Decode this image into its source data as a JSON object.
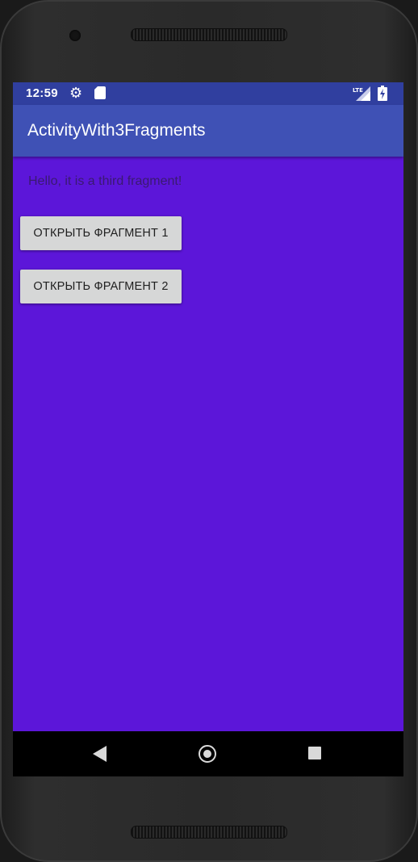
{
  "status_bar": {
    "time": "12:59",
    "icons": [
      "gear-icon",
      "sd-card-icon",
      "lte-signal-icon",
      "battery-icon"
    ],
    "network_label": "LTE"
  },
  "app_bar": {
    "title": "ActivityWith3Fragments"
  },
  "content": {
    "message": "Hello, it is a third fragment!",
    "buttons": [
      {
        "label": "ОТКРЫТЬ ФРАГМЕНТ 1"
      },
      {
        "label": "ОТКРЫТЬ ФРАГМЕНТ 2"
      }
    ]
  },
  "nav_bar": {
    "icons": [
      "back-icon",
      "home-icon",
      "recents-icon"
    ]
  },
  "colors": {
    "status_bar": "#303f9f",
    "app_bar": "#3f51b5",
    "content_background": "#5c16d9",
    "button_background": "#d6d7d7",
    "nav_bar": "#000000"
  }
}
